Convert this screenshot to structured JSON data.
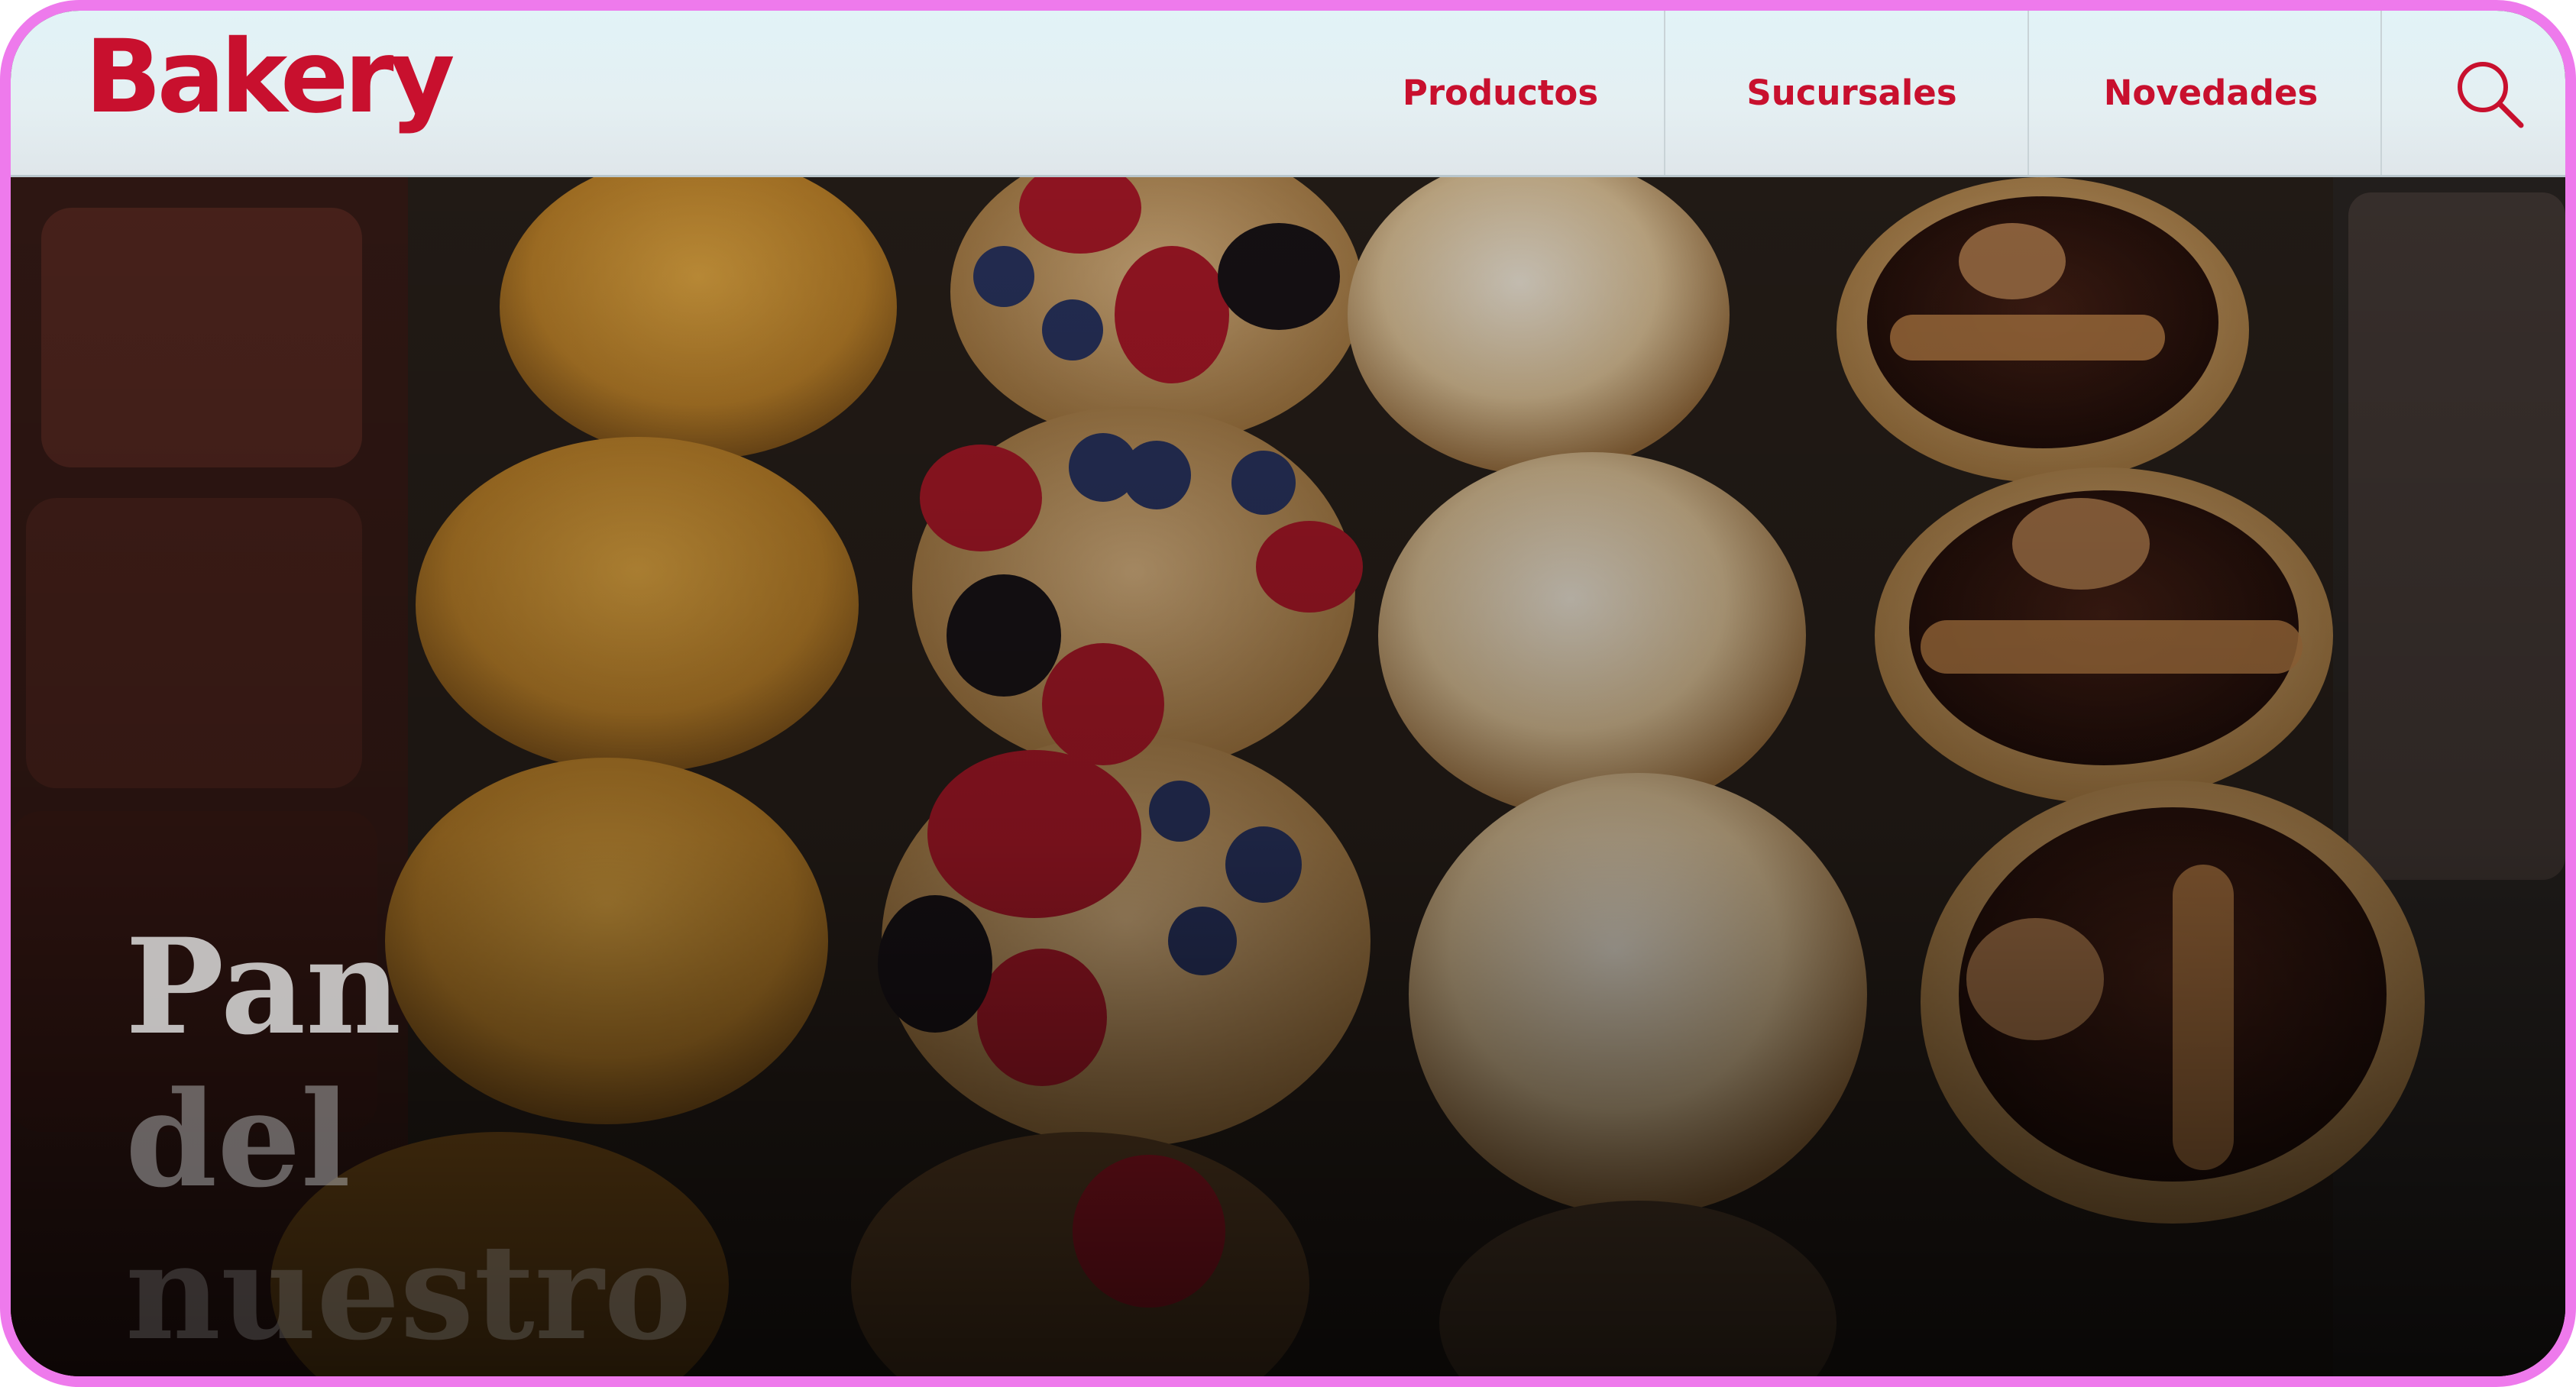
{
  "brand": {
    "name": "Bakery",
    "color": "#c8102e"
  },
  "nav": {
    "items": [
      {
        "label": "Productos"
      },
      {
        "label": "Sucursales"
      },
      {
        "label": "Novedades"
      }
    ],
    "search_icon": "search-icon"
  },
  "hero": {
    "title_lines": [
      "Pan",
      "del",
      "nuestro"
    ],
    "image": "pastry-tray-photo"
  },
  "colors": {
    "accent": "#c8102e",
    "frame": "#ee7aec",
    "header_bg": "#e2f3f7"
  }
}
